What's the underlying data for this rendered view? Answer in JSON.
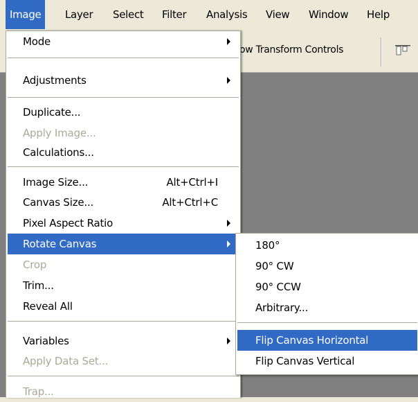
{
  "menubar": {
    "items": [
      {
        "label": "Image"
      },
      {
        "label": "Layer"
      },
      {
        "label": "Select"
      },
      {
        "label": "Filter"
      },
      {
        "label": "Analysis"
      },
      {
        "label": "View"
      },
      {
        "label": "Window"
      },
      {
        "label": "Help"
      }
    ]
  },
  "options_bar": {
    "partial_text": "ow Transform Controls",
    "icon": "align-top-icon"
  },
  "image_menu": {
    "items": [
      {
        "label": "Mode",
        "submenu": true
      },
      {
        "label": "Adjustments",
        "submenu": true
      },
      {
        "label": "Duplicate..."
      },
      {
        "label": "Apply Image...",
        "disabled": true
      },
      {
        "label": "Calculations..."
      },
      {
        "label": "Image Size...",
        "shortcut": "Alt+Ctrl+I"
      },
      {
        "label": "Canvas Size...",
        "shortcut": "Alt+Ctrl+C"
      },
      {
        "label": "Pixel Aspect Ratio",
        "submenu": true
      },
      {
        "label": "Rotate Canvas",
        "submenu": true,
        "highlighted": true
      },
      {
        "label": "Crop",
        "disabled": true
      },
      {
        "label": "Trim..."
      },
      {
        "label": "Reveal All"
      },
      {
        "label": "Variables",
        "submenu": true
      },
      {
        "label": "Apply Data Set...",
        "disabled": true
      },
      {
        "label": "Trap...",
        "disabled": true
      }
    ]
  },
  "rotate_submenu": {
    "items": [
      {
        "label": "180°"
      },
      {
        "label": "90° CW"
      },
      {
        "label": "90° CCW"
      },
      {
        "label": "Arbitrary..."
      },
      {
        "label": "Flip Canvas Horizontal",
        "highlighted": true
      },
      {
        "label": "Flip Canvas Vertical"
      }
    ]
  },
  "colors": {
    "highlight": "#316ac5",
    "menubar_bg": "#ece9d8",
    "canvas_bg": "#808080",
    "disabled_text": "#aca899"
  }
}
